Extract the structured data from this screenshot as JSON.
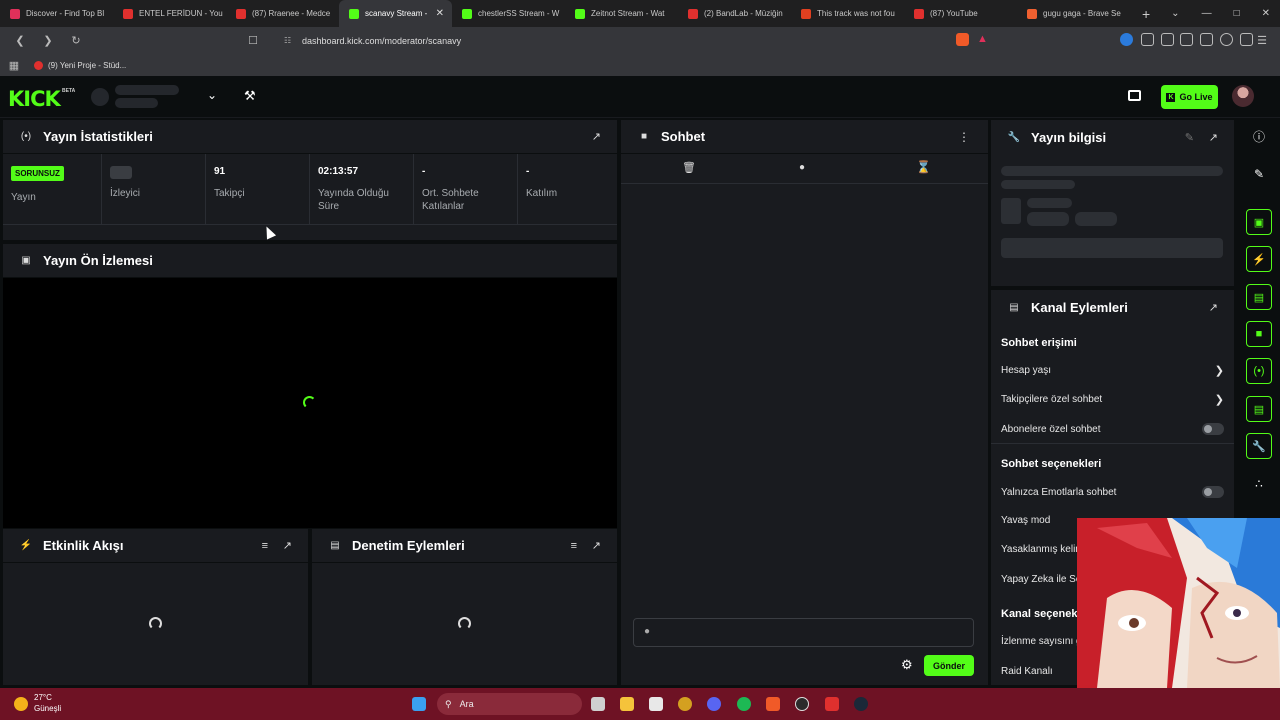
{
  "browser": {
    "tabs": [
      {
        "title": "Discover - Find Top Bl",
        "color": "#e0305a"
      },
      {
        "title": "ENTEL FERİDUN - You",
        "color": "#e0302e"
      },
      {
        "title": "(87) Rraenee - Medce",
        "color": "#e0302e"
      },
      {
        "title": "scanavy Stream -",
        "color": "#53fc18",
        "active": true
      },
      {
        "title": "chestlerSS Stream - W",
        "color": "#53fc18"
      },
      {
        "title": "Zeitnot Stream - Wat",
        "color": "#53fc18"
      },
      {
        "title": "(2) BandLab - Müziğin",
        "color": "#e0302e"
      },
      {
        "title": "This track was not fou",
        "color": "#e04020"
      },
      {
        "title": "(87) YouTube",
        "color": "#e0302e"
      },
      {
        "title": "gugu gaga - Brave Se",
        "color": "#f06030"
      }
    ],
    "url": "dashboard.kick.com/moderator/scanavy",
    "bookmark": "(9) Yeni Proje - Stüd..."
  },
  "kick": {
    "logo": "KICK",
    "beta": "BETA",
    "go_live": "Go Live"
  },
  "stats_panel": {
    "title": "Yayın İstatistikleri",
    "stats": [
      {
        "value": "SORUNSUZ",
        "label": "Yayın"
      },
      {
        "value": "",
        "label": "İzleyici"
      },
      {
        "value": "91",
        "label": "Takipçi"
      },
      {
        "value": "02:13:57",
        "label": "Yayında Olduğu Süre"
      },
      {
        "value": "-",
        "label": "Ort. Sohbete Katılanlar"
      },
      {
        "value": "-",
        "label": "Katılım"
      }
    ]
  },
  "preview_panel": {
    "title": "Yayın Ön İzlemesi"
  },
  "activity_panel": {
    "title": "Etkinlik Akışı"
  },
  "moderation_panel": {
    "title": "Denetim Eylemleri"
  },
  "chat_panel": {
    "title": "Sohbet",
    "send_label": "Gönder"
  },
  "stream_info_panel": {
    "title": "Yayın bilgisi"
  },
  "channel_actions": {
    "title": "Kanal Eylemleri",
    "chat_access": "Sohbet erişimi",
    "account_age": "Hesap yaşı",
    "followers_only": "Takipçilere özel sohbet",
    "subscribers_only": "Abonelere özel sohbet",
    "chat_options": "Sohbet seçenekleri",
    "emote_only": "Yalnızca Emotlarla sohbet",
    "slow_mode": "Yavaş mod",
    "banned_words": "Yasaklanmış kelim",
    "ai_mod": "Yapay Zeka ile So",
    "channel_options": "Kanal seçenek",
    "view_count": "İzlenme sayısını g",
    "raid_channel": "Raid Kanalı"
  },
  "taskbar": {
    "weather_temp": "27°C",
    "weather_desc": "Güneşli",
    "search_placeholder": "Ara"
  }
}
